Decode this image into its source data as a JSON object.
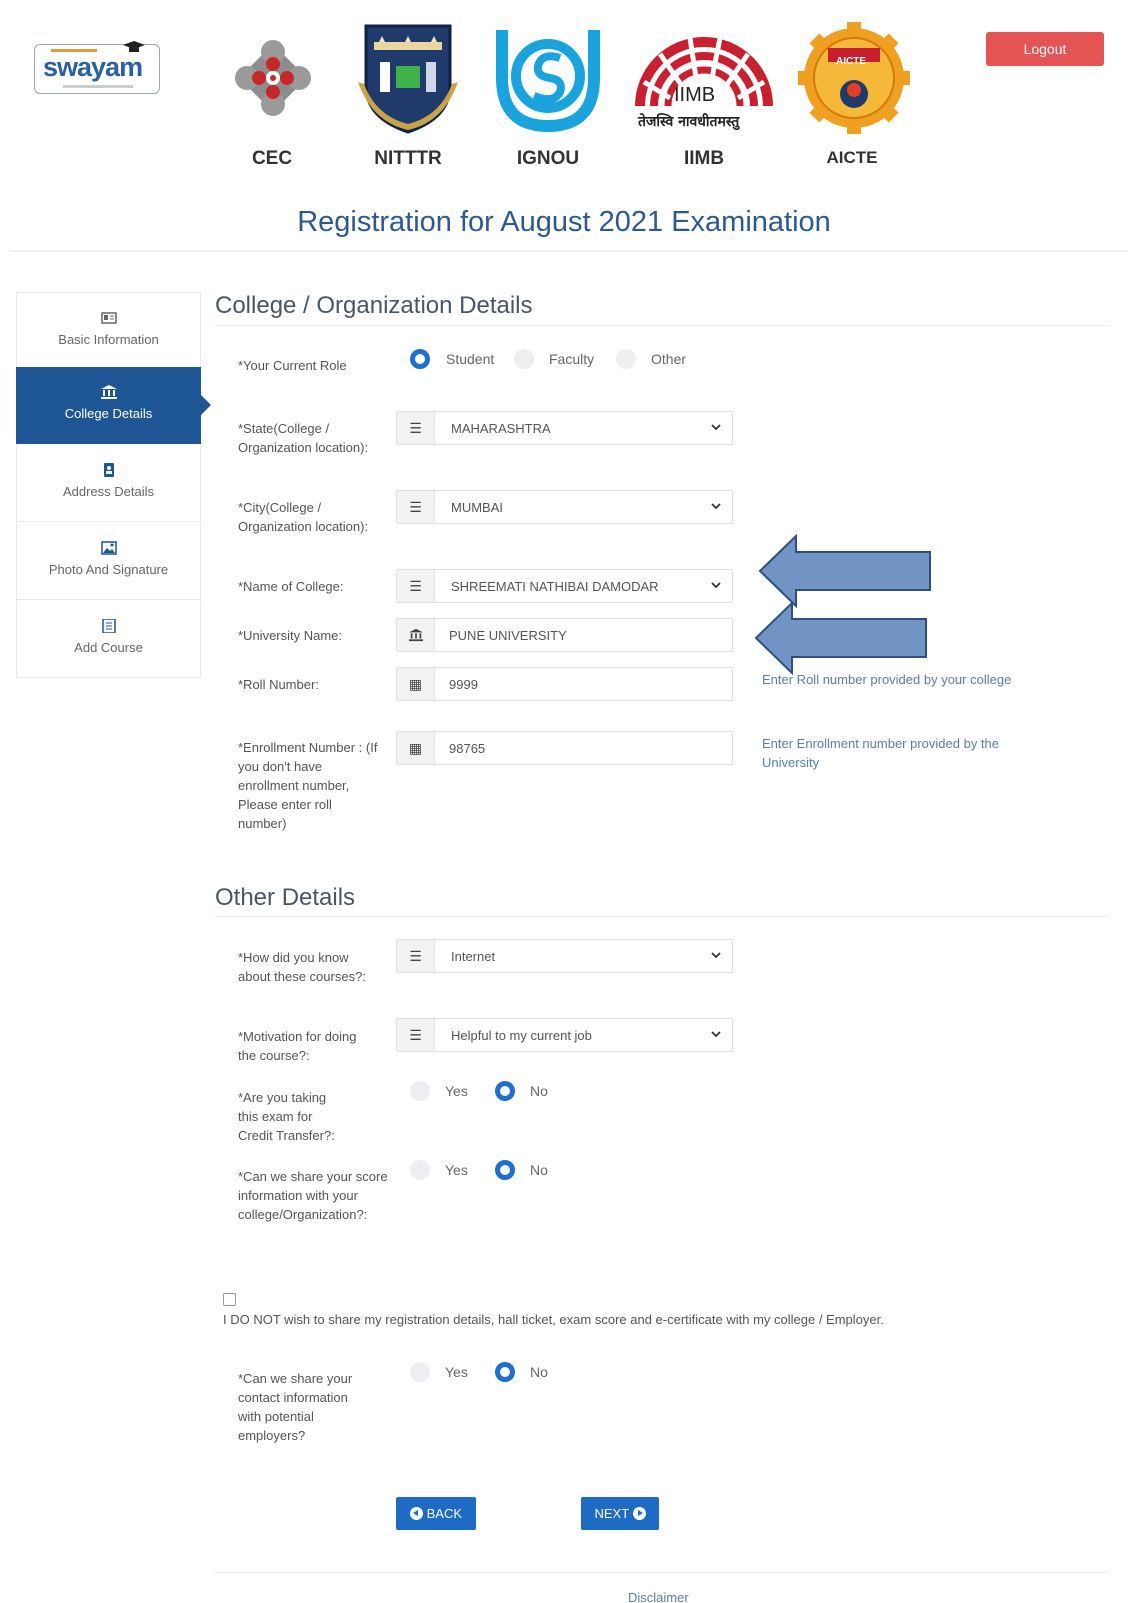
{
  "header": {
    "swayam_logo_text": "swayam",
    "institutions": [
      "CEC",
      "NITTTR",
      "IGNOU",
      "IIMB",
      "AICTE"
    ],
    "iimb_logo_text": "IIMB",
    "iimb_motto": "तेजस्वि नावधीतमस्तु",
    "aicte_logo_text": "AICTE",
    "logout_label": "Logout"
  },
  "page_title": "Registration for August 2021 Examination",
  "sidebar": {
    "items": [
      {
        "label": "Basic Information",
        "icon": "id-card-icon",
        "active": false
      },
      {
        "label": "College Details",
        "icon": "institution-icon",
        "active": true
      },
      {
        "label": "Address Details",
        "icon": "address-book-icon",
        "active": false
      },
      {
        "label": "Photo And Signature",
        "icon": "image-icon",
        "active": false
      },
      {
        "label": "Add Course",
        "icon": "list-icon",
        "active": false
      }
    ]
  },
  "college": {
    "section_title": "College / Organization Details",
    "role_label": "*Your Current Role",
    "role_options": [
      "Student",
      "Faculty",
      "Other"
    ],
    "role_selected": "Student",
    "state_label": "*State(College / Organization location):",
    "state_value": "MAHARASHTRA",
    "city_label": "*City(College / Organization location):",
    "city_value": "MUMBAI",
    "college_label": "*Name of College:",
    "college_value": "SHREEMATI NATHIBAI DAMODAR",
    "university_label": "*University Name:",
    "university_value": "PUNE UNIVERSITY",
    "roll_label": "*Roll Number:",
    "roll_value": "9999",
    "roll_hint": "Enter Roll number provided by your college",
    "enroll_label": "*Enrollment Number : (If you don't have enrollment number, Please enter roll number)",
    "enroll_value": "98765",
    "enroll_hint": "Enter Enrollment number provided by the University"
  },
  "other": {
    "section_title": "Other Details",
    "source_label": "*How did you know about these courses?:",
    "source_value": "Internet",
    "motivation_label": "*Motivation for doing the course?:",
    "motivation_value": "Helpful to my current job",
    "credit_label": "*Are you taking this exam for Credit Transfer?:",
    "share_score_label": "*Can we share your score information with your college/Organization?:",
    "no_share_checkbox_label": "I DO NOT wish to share my registration details, hall ticket, exam score and e-certificate with my college / Employer.",
    "share_contact_label": "*Can we share your contact information with potential employers?",
    "yes_label": "Yes",
    "no_label": "No",
    "credit_selected": "No",
    "share_score_selected": "No",
    "share_contact_selected": "No"
  },
  "buttons": {
    "back_label": "BACK",
    "next_label": "NEXT"
  },
  "footer": {
    "disclaimer": "Disclaimer"
  },
  "colors": {
    "primary": "#1d5595",
    "button": "#1d6bc4",
    "logout": "#e55454",
    "arrow_fill": "#7294c4",
    "arrow_stroke": "#2e4f80"
  }
}
